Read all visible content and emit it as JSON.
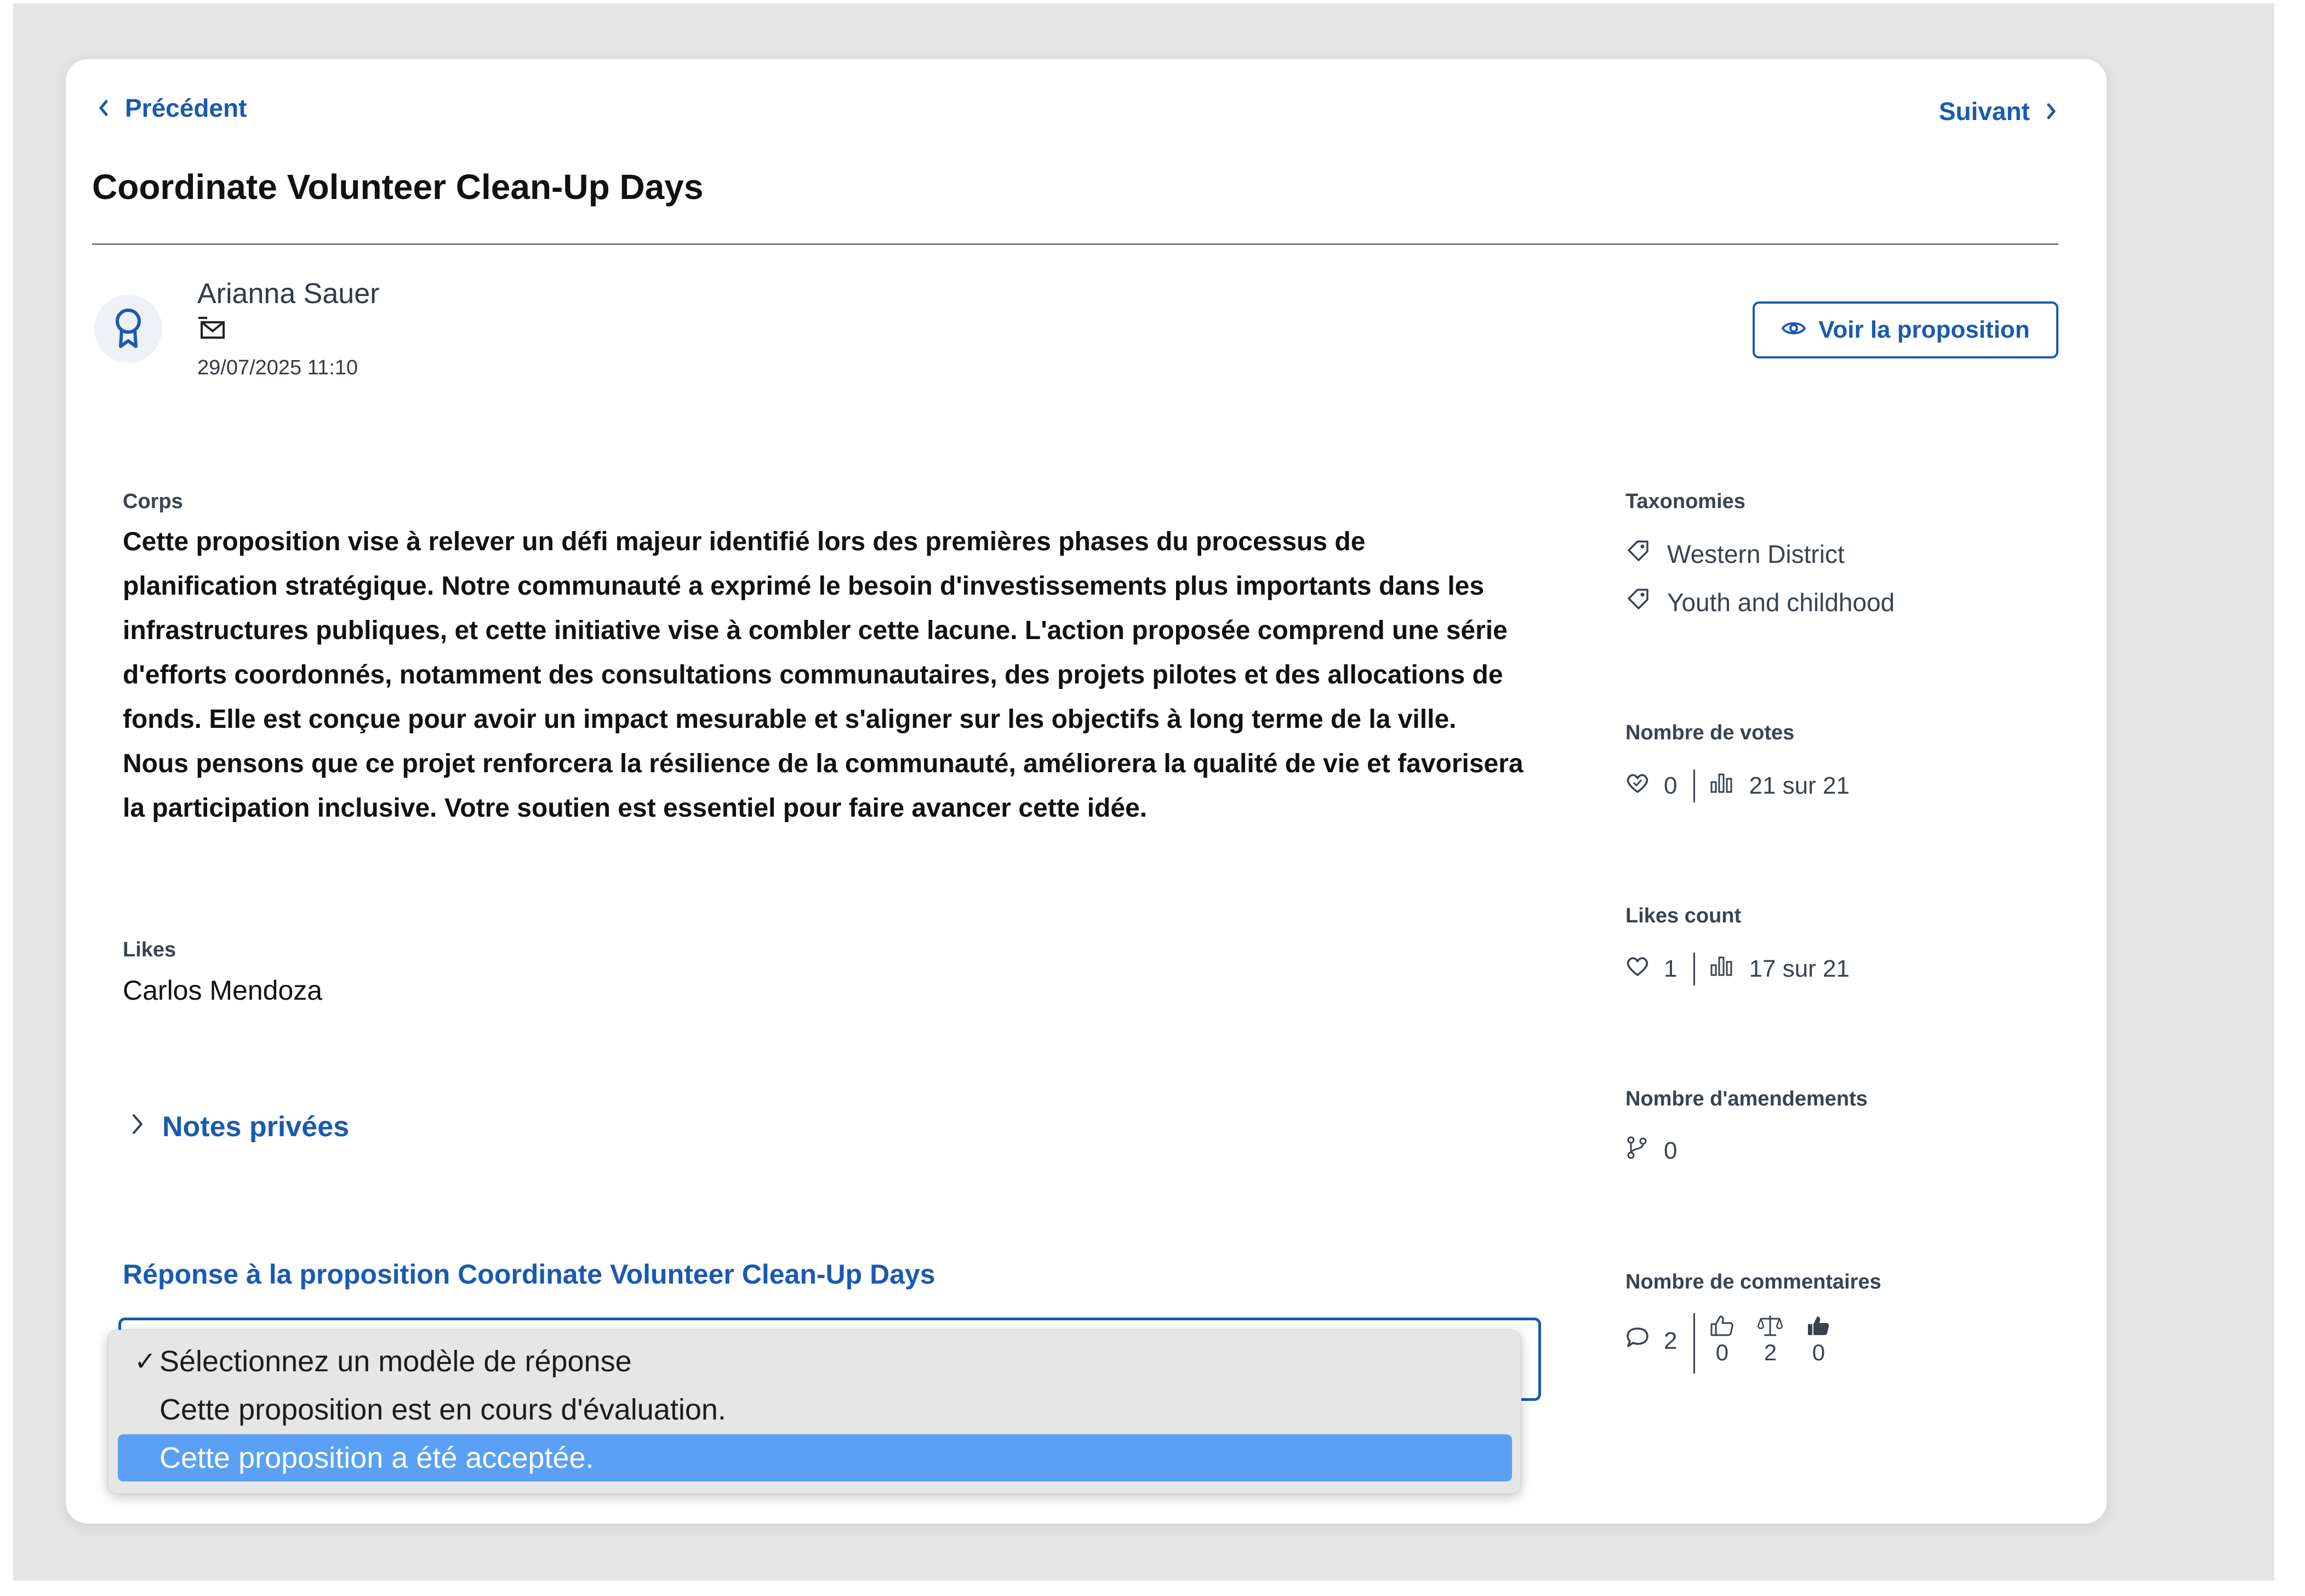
{
  "nav": {
    "previous_label": "Précédent",
    "next_label": "Suivant"
  },
  "proposal": {
    "title": "Coordinate Volunteer Clean-Up Days"
  },
  "author": {
    "name": "Arianna Sauer",
    "date": "29/07/2025 11:10"
  },
  "view_button_label": "Voir la proposition",
  "body": {
    "label": "Corps",
    "text": "Cette proposition vise à relever un défi majeur identifié lors des premières phases du processus de planification stratégique. Notre communauté a exprimé le besoin d'investissements plus importants dans les infrastructures publiques, et cette initiative vise à combler cette lacune. L'action proposée comprend une série d'efforts coordonnés, notamment des consultations communautaires, des projets pilotes et des allocations de fonds. Elle est conçue pour avoir un impact mesurable et s'aligner sur les objectifs à long terme de la ville. Nous pensons que ce projet renforcera la résilience de la communauté, améliorera la qualité de vie et favorisera la participation inclusive. Votre soutien est essentiel pour faire avancer cette idée."
  },
  "likes": {
    "label": "Likes",
    "value": "Carlos Mendoza"
  },
  "notes_label": "Notes privées",
  "response": {
    "title": "Réponse à la proposition Coordinate Volunteer Clean-Up Days",
    "options": [
      {
        "label": "Sélectionnez un modèle de réponse",
        "checked": true,
        "highlighted": false
      },
      {
        "label": "Cette proposition est en cours d'évaluation.",
        "checked": false,
        "highlighted": false
      },
      {
        "label": "Cette proposition a été acceptée.",
        "checked": false,
        "highlighted": true
      }
    ],
    "check_mark": "✓"
  },
  "sidebar": {
    "taxonomies": {
      "label": "Taxonomies",
      "items": [
        "Western District",
        "Youth and childhood"
      ]
    },
    "votes": {
      "label": "Nombre de votes",
      "count": "0",
      "ranking": "21 sur 21"
    },
    "likes_count": {
      "label": "Likes count",
      "count": "1",
      "ranking": "17 sur 21"
    },
    "amendments": {
      "label": "Nombre d'amendements",
      "count": "0"
    },
    "comments": {
      "label": "Nombre de commentaires",
      "count": "2",
      "positive": "0",
      "neutral": "2",
      "negative": "0"
    }
  },
  "colors": {
    "accent": "#1a5ab0",
    "highlight": "#5aa0f5",
    "text_muted": "#3a4350"
  }
}
